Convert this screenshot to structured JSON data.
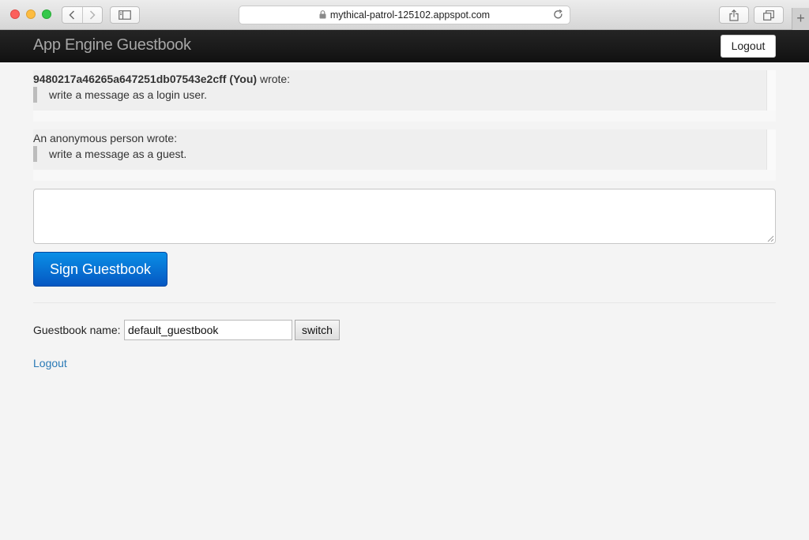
{
  "browser": {
    "url": "mythical-patrol-125102.appspot.com",
    "icons": [
      "back-icon",
      "forward-icon",
      "sidebar-icon",
      "lock-icon",
      "reload-icon",
      "share-icon",
      "tabs-icon",
      "new-tab-icon"
    ],
    "new_tab_glyph": "+"
  },
  "navbar": {
    "brand": "App Engine Guestbook",
    "logout_label": "Logout"
  },
  "greetings": [
    {
      "author": "9480217a46265a647251db07543e2cff (You)",
      "suffix": " wrote:",
      "content": "write a message as a login user."
    },
    {
      "author": "",
      "suffix": "An anonymous person wrote:",
      "content": "write a message as a guest."
    }
  ],
  "form": {
    "message_value": "",
    "submit_label": "Sign Guestbook"
  },
  "guestbook": {
    "name_label": "Guestbook name:",
    "name_value": "default_guestbook",
    "switch_label": "switch"
  },
  "footer": {
    "logout_link": "Logout"
  },
  "colors": {
    "navbar_bg": "#1a1a1a",
    "brand_text": "#a6a6a6",
    "primary_button": "#0a6fd8",
    "link": "#2a7ab6",
    "page_bg": "#f4f4f4"
  }
}
